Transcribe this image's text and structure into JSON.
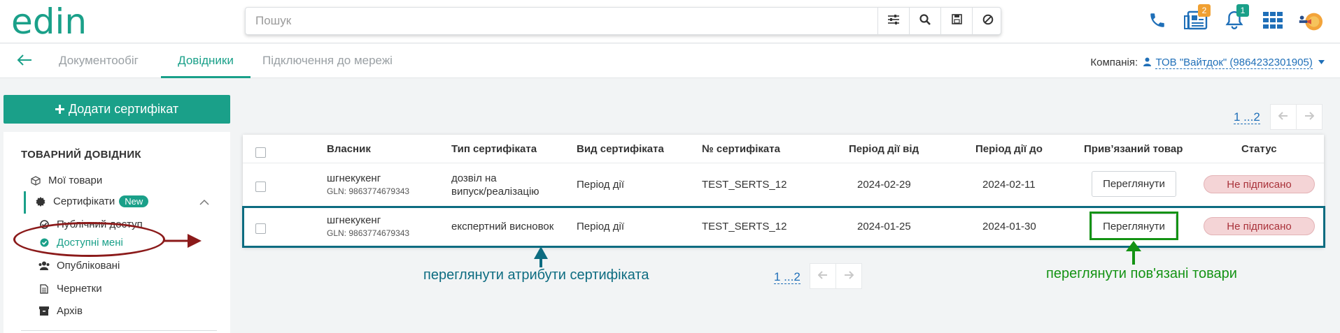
{
  "header": {
    "logo_text": "edin",
    "search_placeholder": "Пошук",
    "icons": [
      "filter-icon",
      "search-icon",
      "save-icon",
      "clear-icon",
      "phone-icon",
      "documents-icon",
      "bell-icon",
      "apps-grid-icon",
      "avatar"
    ],
    "documents_badge": "2",
    "notifications_badge": "1",
    "colors": {
      "brand": "#1aa089",
      "documents_badge": "#f0a032",
      "notifications_badge": "#1aa089",
      "link": "#1f6fb8"
    }
  },
  "nav": {
    "tabs": [
      {
        "label": "Документообіг",
        "active": false
      },
      {
        "label": "Довідники",
        "active": true
      },
      {
        "label": "Підключення до мережі",
        "active": false
      }
    ],
    "company_label": "Компанія:",
    "company_value": "ТОВ \"Вайтдок\" (9864232301905)"
  },
  "add_button": "Додати сертифікат",
  "sidebar": {
    "heading": "ТОВАРНИЙ ДОВІДНИК",
    "items": [
      {
        "label": "Мої товари",
        "icon": "box-icon"
      },
      {
        "label": "Сертифікати",
        "icon": "certificate-icon",
        "badge": "New",
        "expanded": true
      },
      {
        "label": "Публічний доступ",
        "icon": "check-circle-icon"
      },
      {
        "label": "Доступні мені",
        "icon": "check-circle-filled-icon",
        "active": true
      },
      {
        "label": "Опубліковані",
        "icon": "users-icon"
      },
      {
        "label": "Чернетки",
        "icon": "document-icon"
      },
      {
        "label": "Архів",
        "icon": "archive-icon"
      }
    ]
  },
  "pager": {
    "text": "1 ...2"
  },
  "table": {
    "columns": [
      "Власник",
      "Тип сертифіката",
      "Вид сертифіката",
      "№ сертифіката",
      "Період дії від",
      "Період дії до",
      "Прив’язаний товар",
      "Статус"
    ],
    "rows": [
      {
        "owner": "шгнекукенг",
        "gln": "GLN: 9863774679343",
        "type_line1": "дозвіл на",
        "type_line2": "випуск/реалізацію",
        "kind": "Період дії",
        "number": "TEST_SERTS_12",
        "from": "2024-02-29",
        "to": "2024-02-11",
        "product_button": "Переглянути",
        "status": "Не підписано"
      },
      {
        "owner": "шгнекукенг",
        "gln": "GLN: 9863774679343",
        "type_line1": "експертний висновок",
        "type_line2": "",
        "kind": "Період дії",
        "number": "TEST_SERTS_12",
        "from": "2024-01-25",
        "to": "2024-01-30",
        "product_button": "Переглянути",
        "status": "Не підписано"
      }
    ]
  },
  "annotations": {
    "view_attributes": "переглянути атрибути сертифіката",
    "view_products": "переглянути пов'язані товари",
    "colors": {
      "teal": "#0d6c81",
      "green": "#149314",
      "darkred": "#8b1a1a"
    }
  }
}
